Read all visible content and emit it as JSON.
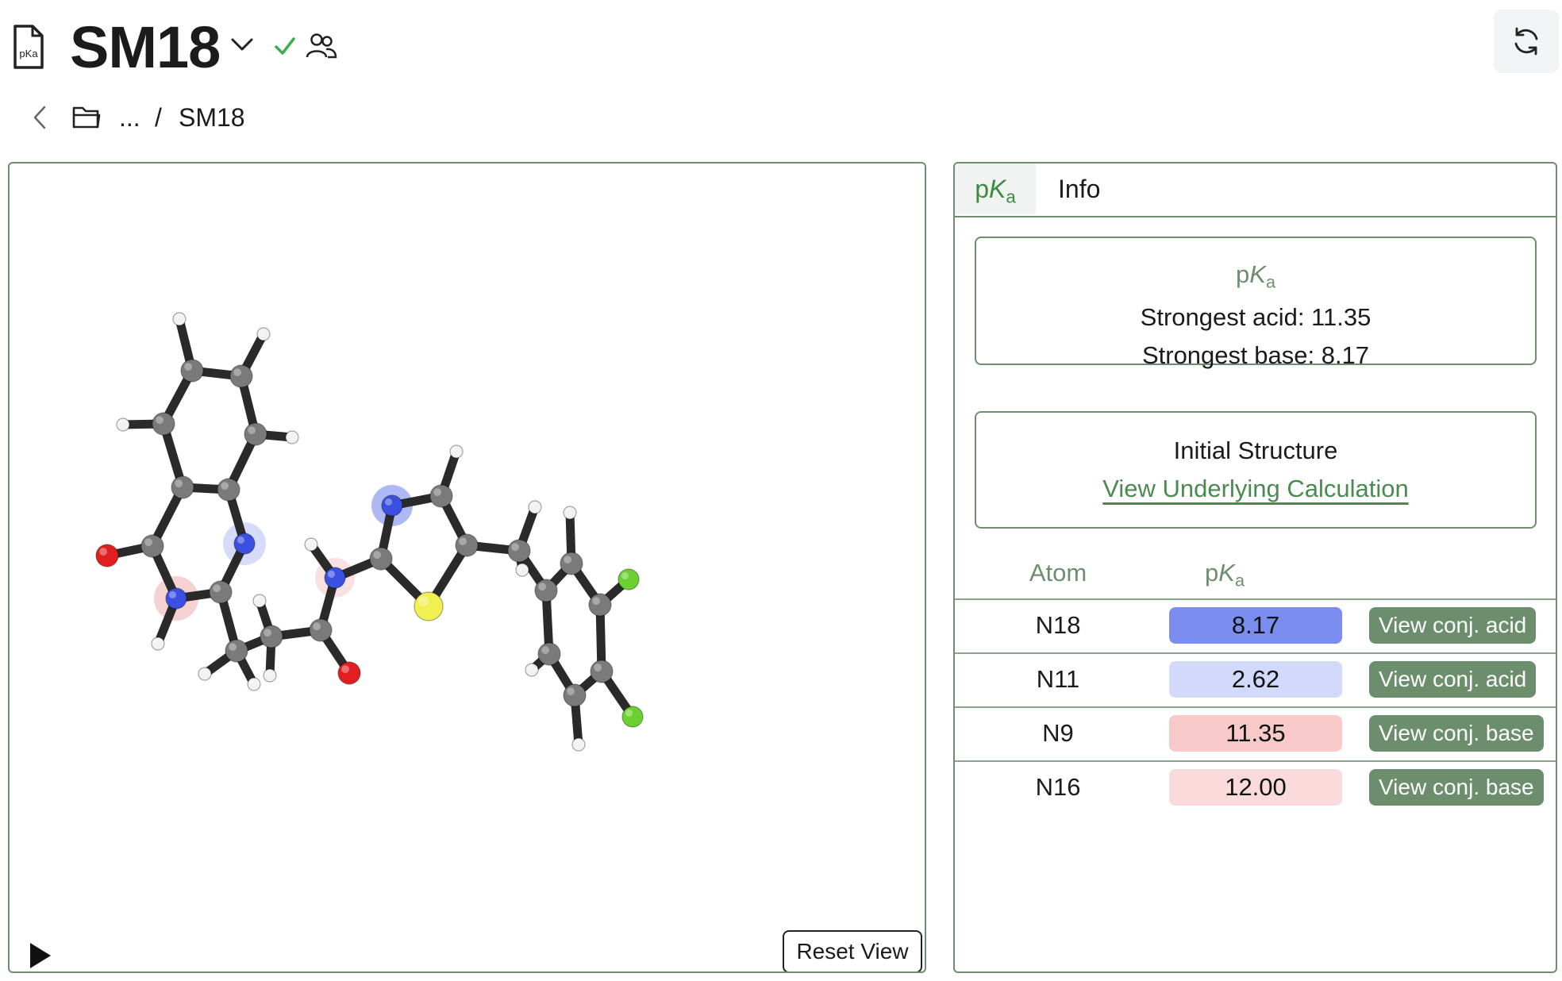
{
  "header": {
    "title": "SM18",
    "doc_icon_text": "pKa",
    "status": "saved",
    "refresh_icon": "refresh-icon"
  },
  "breadcrumb": {
    "ellipsis": "...",
    "separator": "/",
    "current": "SM18"
  },
  "viewer": {
    "reset_label": "Reset View",
    "play_icon": "play-icon"
  },
  "tabs": {
    "pka": {
      "p": "p",
      "K": "K",
      "a": "a"
    },
    "info": "Info",
    "active": "pKa"
  },
  "summary": {
    "heading": {
      "p": "p",
      "K": "K",
      "a": "a"
    },
    "strongest_acid": "Strongest acid: 11.35",
    "strongest_base": "Strongest base: 8.17"
  },
  "structure_card": {
    "title": "Initial Structure",
    "link": "View Underlying Calculation"
  },
  "table": {
    "col_atom": "Atom",
    "col_pka": {
      "p": "p",
      "K": "K",
      "a": "a"
    },
    "rows": [
      {
        "atom": "N18",
        "pka": "8.17",
        "pill_color": "#7b8ef0",
        "action": "View conj. acid"
      },
      {
        "atom": "N11",
        "pka": "2.62",
        "pill_color": "#d3d9fb",
        "action": "View conj. acid"
      },
      {
        "atom": "N9",
        "pka": "11.35",
        "pill_color": "#f7c9c9",
        "action": "View conj. base"
      },
      {
        "atom": "N16",
        "pka": "12.00",
        "pill_color": "#fadada",
        "action": "View conj. base"
      }
    ]
  },
  "colors": {
    "accent_green": "#6c8e6d",
    "carbon": "#7a7a7a",
    "hydrogen": "#f2f2f2",
    "nitrogen": "#3b50e0",
    "oxygen": "#e02020",
    "sulfur": "#f0f050",
    "fluorine": "#6bd030"
  }
}
